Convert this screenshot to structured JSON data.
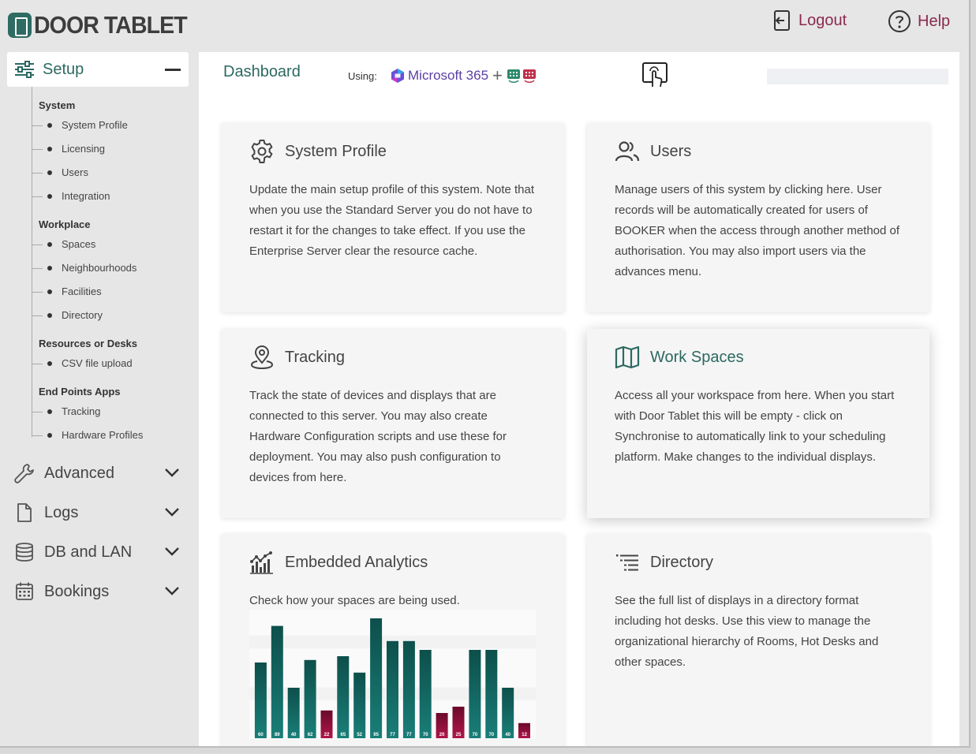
{
  "app": {
    "logo_text": "DOOR TABLET",
    "logout_label": "Logout",
    "help_label": "Help"
  },
  "sidebar": {
    "setup_label": "Setup",
    "groups": [
      {
        "title": "System",
        "items": [
          "System Profile",
          "Licensing",
          "Users",
          "Integration"
        ]
      },
      {
        "title": "Workplace",
        "items": [
          "Spaces",
          "Neighbourhoods",
          "Facilities",
          "Directory"
        ]
      },
      {
        "title": "Resources or Desks",
        "items": [
          "CSV file upload"
        ]
      },
      {
        "title": "End Points Apps",
        "items": [
          "Tracking",
          "Hardware Profiles"
        ]
      }
    ],
    "nav": [
      {
        "label": "Advanced",
        "icon": "wrench-icon"
      },
      {
        "label": "Logs",
        "icon": "file-icon"
      },
      {
        "label": "DB and LAN",
        "icon": "database-icon"
      },
      {
        "label": "Bookings",
        "icon": "calendar-icon"
      }
    ]
  },
  "main": {
    "title": "Dashboard",
    "using_label": "Using:",
    "platform_label": "Microsoft 365",
    "plus": "+"
  },
  "cards": [
    {
      "title": "System Profile",
      "icon": "gear-icon",
      "body": "Update the main setup profile of this system. Note that when you use the Standard Server you do not have to restart it for the changes to take effect. If you use the Enterprise Server clear the resource cache."
    },
    {
      "title": "Users",
      "icon": "users-icon",
      "body": "Manage users of this system by clicking here. User records will be automatically created for users of BOOKER when the access through another method of authorisation. You may also import users via the advances menu."
    },
    {
      "title": "Tracking",
      "icon": "location-pin-icon",
      "body": "Track the state of devices and displays that are connected to this server. You may also create Hardware Configuration scripts and use these for deployment. You may also push configuration to devices from here."
    },
    {
      "title": "Work Spaces",
      "icon": "map-icon",
      "body": "Access all your workspace from here. When you start with Door Tablet this will be empty - click on Synchronise to automatically link to your scheduling platform. Make changes to the individual displays."
    },
    {
      "title": "Embedded Analytics",
      "icon": "analytics-icon",
      "body": "Check how your spaces are being used."
    },
    {
      "title": "Directory",
      "icon": "list-icon",
      "body": "See the full list of displays in a directory format including hot desks. Use this view to manage the organizational hierarchy of Rooms, Hot Desks and other spaces."
    }
  ],
  "chart_data": {
    "type": "bar",
    "values": [
      60,
      89,
      40,
      62,
      22,
      65,
      52,
      95,
      77,
      77,
      70,
      20,
      25,
      70,
      70,
      40,
      12
    ],
    "highlighted_indices": [
      4,
      11,
      12,
      16
    ],
    "colors": {
      "normal": "#1a7e78",
      "low": "#b0154a"
    },
    "ylim": [
      0,
      100
    ]
  }
}
